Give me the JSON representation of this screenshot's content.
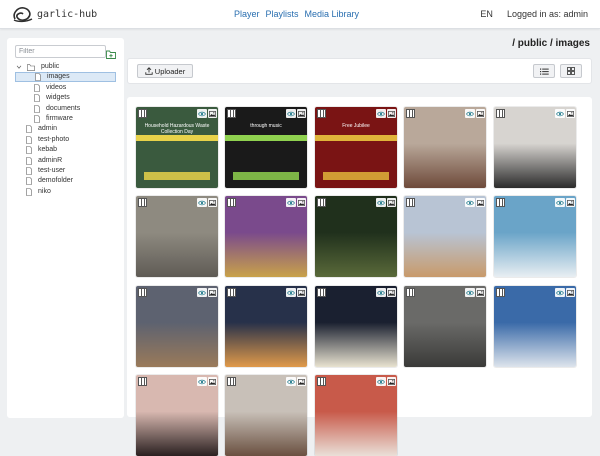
{
  "app": {
    "name": "garlic-hub"
  },
  "nav": {
    "items": [
      "Player",
      "Playlists",
      "Media Library"
    ]
  },
  "header": {
    "language": "EN",
    "user": "Logged in as: admin"
  },
  "sidebar": {
    "filter_placeholder": "Filter",
    "tree": [
      {
        "label": "public",
        "type": "folder-open",
        "level": 0
      },
      {
        "label": "images",
        "type": "file",
        "level": 1,
        "selected": true
      },
      {
        "label": "videos",
        "type": "file",
        "level": 1
      },
      {
        "label": "widgets",
        "type": "file",
        "level": 1
      },
      {
        "label": "documents",
        "type": "file",
        "level": 1
      },
      {
        "label": "firmware",
        "type": "file",
        "level": 1
      },
      {
        "label": "admin",
        "type": "file",
        "level": 0
      },
      {
        "label": "test-photo",
        "type": "file",
        "level": 0
      },
      {
        "label": "kebab",
        "type": "file",
        "level": 0
      },
      {
        "label": "adminR",
        "type": "file",
        "level": 0
      },
      {
        "label": "test-user",
        "type": "file",
        "level": 0
      },
      {
        "label": "demofolder",
        "type": "file",
        "level": 0
      },
      {
        "label": "niko",
        "type": "file",
        "level": 0
      }
    ]
  },
  "breadcrumb": "/ public / images",
  "toolbar": {
    "uploader_label": "Uploader",
    "views": [
      "list-view-icon",
      "grid-view-icon"
    ]
  },
  "gallery": {
    "items": [
      {
        "kind": "poster",
        "bg": "#3a5a3e",
        "accent": "#e8d24a",
        "text": "Household Hazardous Waste Collection Day"
      },
      {
        "kind": "poster",
        "bg": "#1a1a1a",
        "accent": "#8fd14f",
        "text": "through music"
      },
      {
        "kind": "poster",
        "bg": "#7a1414",
        "accent": "#e0b43a",
        "text": "Free Jubilee"
      },
      {
        "kind": "photo",
        "bg": "#b9a89a",
        "accent": "#6e4a3a"
      },
      {
        "kind": "photo",
        "bg": "#d7d4d0",
        "accent": "#2b2b2b"
      },
      {
        "kind": "photo",
        "bg": "#8e8a80",
        "accent": "#5f5b55"
      },
      {
        "kind": "photo",
        "bg": "#7a4a8c",
        "accent": "#c9a24a"
      },
      {
        "kind": "photo",
        "bg": "#20301c",
        "accent": "#5a6a3a"
      },
      {
        "kind": "photo",
        "bg": "#b8c4d4",
        "accent": "#c89a6a"
      },
      {
        "kind": "photo",
        "bg": "#6aa4c8",
        "accent": "#e8eef2"
      },
      {
        "kind": "photo",
        "bg": "#5d6270",
        "accent": "#9a7a5a"
      },
      {
        "kind": "photo",
        "bg": "#27314a",
        "accent": "#e09a4a"
      },
      {
        "kind": "photo",
        "bg": "#1a2030",
        "accent": "#e8e2d0"
      },
      {
        "kind": "photo",
        "bg": "#6a6a68",
        "accent": "#3a3a38"
      },
      {
        "kind": "photo",
        "bg": "#3a6aa8",
        "accent": "#dde4ec"
      },
      {
        "kind": "photo",
        "bg": "#d8b8b0",
        "accent": "#2a2020"
      },
      {
        "kind": "photo",
        "bg": "#c8c0b8",
        "accent": "#6a5040"
      },
      {
        "kind": "photo",
        "bg": "#c85a4a",
        "accent": "#eae0d8"
      }
    ]
  }
}
